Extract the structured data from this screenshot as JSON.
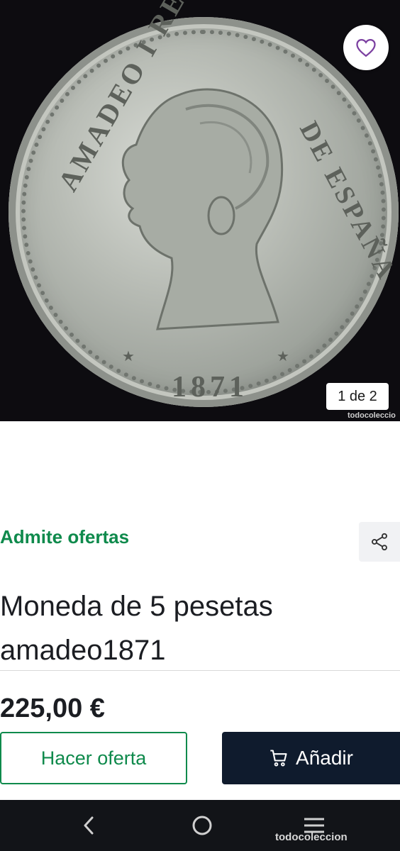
{
  "gallery": {
    "counter": "1 de 2",
    "watermark": "todocoleccio",
    "coin": {
      "legend_left": "AMADEO I REY",
      "legend_right": "DE ESPAÑA",
      "year": "1871"
    }
  },
  "favorite": {
    "icon": "heart-icon"
  },
  "listing": {
    "offers_label": "Admite ofertas",
    "share_icon": "share-icon",
    "title": "Moneda de 5 pesetas amadeo1871",
    "price": "225,00 €"
  },
  "actions": {
    "make_offer": "Hacer oferta",
    "add": "Añadir",
    "add_icon": "cart-icon"
  },
  "system_nav": {
    "back_icon": "back-icon",
    "home_icon": "home-icon",
    "menu_icon": "menu-icon",
    "brand": "todocoleccion"
  },
  "colors": {
    "accent_green": "#0f8a4c",
    "primary_dark": "#0f1b2d",
    "favorite_purple": "#7b3fa0"
  }
}
